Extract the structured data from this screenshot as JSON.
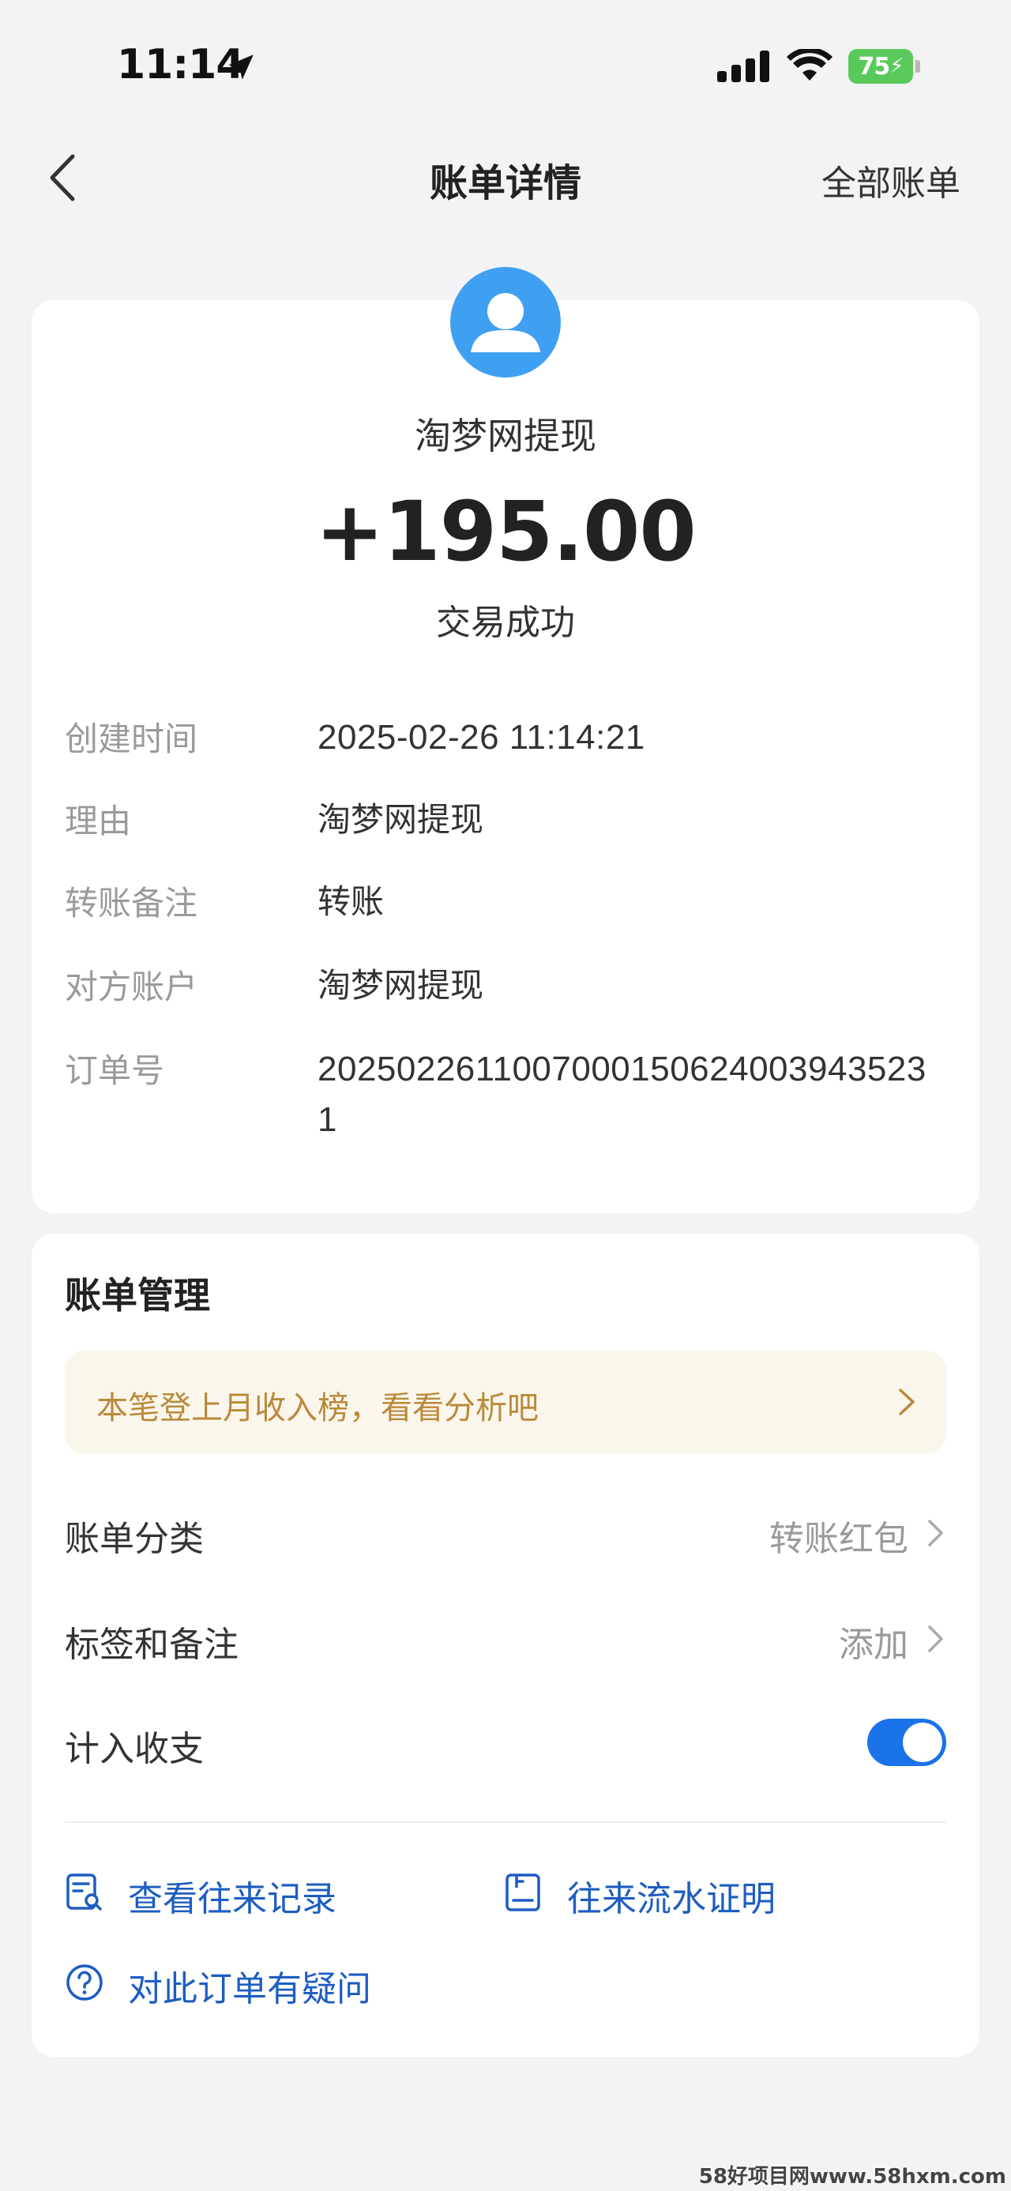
{
  "status_bar": {
    "time": "11:14",
    "battery": "75",
    "icons": [
      "location-arrow-icon",
      "signal-icon",
      "wifi-icon",
      "battery-charging-icon"
    ]
  },
  "nav": {
    "back_icon": "chevron-left-icon",
    "title": "账单详情",
    "right_link": "全部账单"
  },
  "summary": {
    "avatar_icon": "user-avatar-icon",
    "merchant": "淘梦网提现",
    "amount": "+195.00",
    "status": "交易成功"
  },
  "details": [
    {
      "label": "创建时间",
      "value": "2025-02-26 11:14:21"
    },
    {
      "label": "理由",
      "value": "淘梦网提现"
    },
    {
      "label": "转账备注",
      "value": "转账"
    },
    {
      "label": "对方账户",
      "value": "淘梦网提现"
    },
    {
      "label": "订单号",
      "value": "20250226110070001506240039435231"
    }
  ],
  "manage": {
    "title": "账单管理",
    "promo": "本笔登上月收入榜，看看分析吧",
    "category": {
      "label": "账单分类",
      "value": "转账红包"
    },
    "tags": {
      "label": "标签和备注",
      "value": "添加"
    },
    "count_in": {
      "label": "计入收支",
      "enabled": true
    },
    "links": {
      "records": "查看往来记录",
      "proof": "往来流水证明",
      "question": "对此订单有疑问"
    }
  },
  "colors": {
    "accent": "#1a73e8",
    "link": "#1d5dc2",
    "avatar": "#3fa0f2",
    "promo_bg": "#fbf6ec",
    "promo_text": "#b98a3a",
    "battery": "#5ac95c"
  },
  "watermark": "58好项目网www.58hxm.com"
}
